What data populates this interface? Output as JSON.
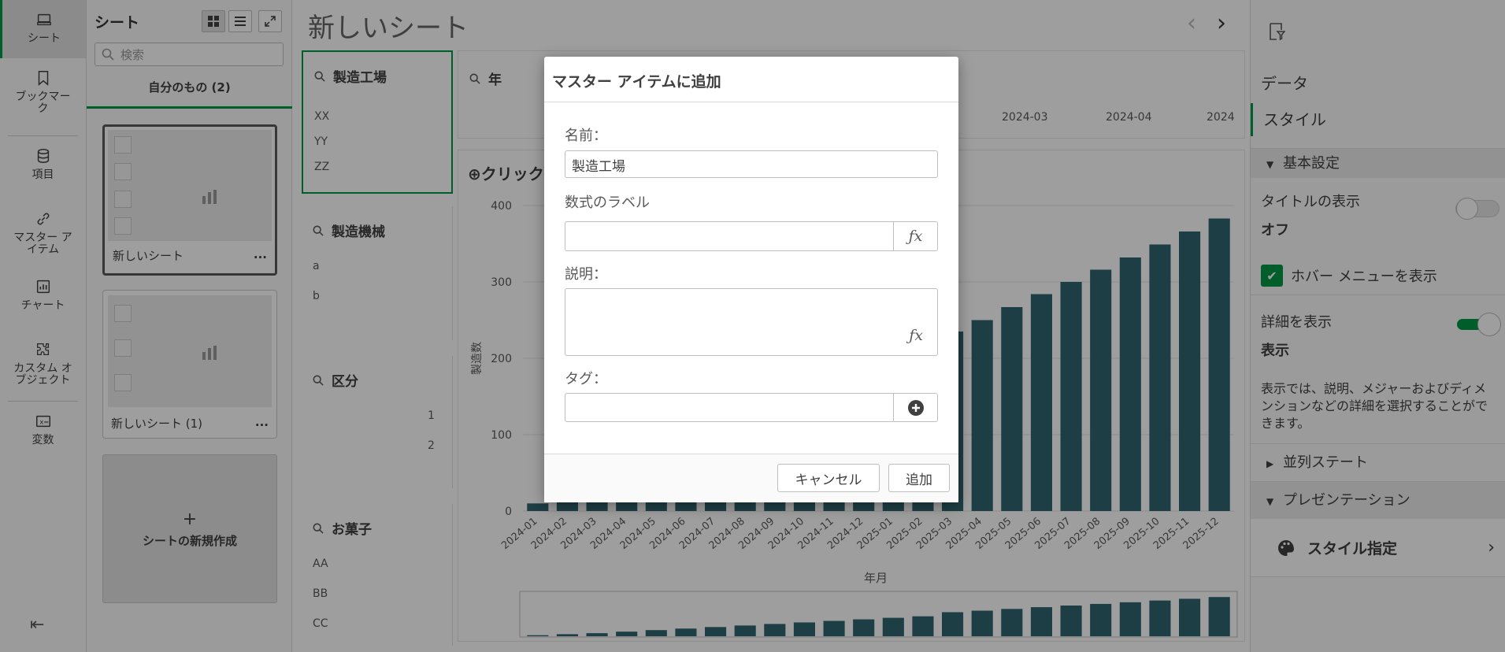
{
  "rail": {
    "items": [
      {
        "label": "シート",
        "icon": "sheet-icon",
        "active": true
      },
      {
        "label": "ブックマーク",
        "icon": "bookmark-icon"
      },
      {
        "label": "項目",
        "icon": "database-icon"
      },
      {
        "label": "マスター アイテム",
        "icon": "link-icon"
      },
      {
        "label": "チャート",
        "icon": "chart-icon"
      },
      {
        "label": "カスタム オブジェクト",
        "icon": "puzzle-icon"
      },
      {
        "label": "変数",
        "icon": "variable-icon"
      }
    ]
  },
  "sheets_panel": {
    "title": "シート",
    "search_placeholder": "検索",
    "tab_label": "自分のもの (2)",
    "cards": [
      {
        "name": "新しいシート",
        "more": "..."
      },
      {
        "name": "新しいシート (1)",
        "more": "..."
      }
    ],
    "new_sheet_label": "シートの新規作成",
    "new_sheet_plus": "+"
  },
  "main": {
    "sheet_title": "新しいシート",
    "filters": [
      {
        "title": "製造工場",
        "values": [
          "XX",
          "YY",
          "ZZ"
        ]
      },
      {
        "title": "製造機械",
        "values": [
          "a",
          "b"
        ]
      },
      {
        "title": "区分",
        "values": [
          "1",
          "2"
        ]
      },
      {
        "title": "お菓子",
        "values": [
          "AA",
          "BB",
          "CC"
        ]
      }
    ],
    "year_filter": {
      "title": "年",
      "visible_values": [
        "2024-03",
        "2024-04",
        "2024"
      ]
    },
    "chart_prompt": "クリック"
  },
  "chart_data": {
    "type": "bar",
    "ylabel": "製造数",
    "xlabel": "年月",
    "ylim": [
      0,
      400
    ],
    "yticks": [
      0,
      100,
      200,
      300,
      400
    ],
    "categories": [
      "2024-01",
      "2024-02",
      "2024-03",
      "2024-04",
      "2024-05",
      "2024-06",
      "2024-07",
      "2024-08",
      "2024-09",
      "2024-10",
      "2024-11",
      "2024-12",
      "2025-01",
      "2025-02",
      "2025-03",
      "2025-04",
      "2025-05",
      "2025-06",
      "2025-07",
      "2025-08",
      "2025-09",
      "2025-10",
      "2025-11",
      "2025-12"
    ],
    "values": [
      10,
      20,
      30,
      45,
      60,
      75,
      90,
      105,
      120,
      135,
      150,
      165,
      180,
      195,
      235,
      250,
      267,
      284,
      300,
      316,
      332,
      349,
      366,
      383
    ],
    "color": "#2f6470"
  },
  "props": {
    "tabs": [
      "データ",
      "スタイル"
    ],
    "basic_section": "基本設定",
    "title_display_label": "タイトルの表示",
    "title_display_value": "オフ",
    "hover_menu_label": "ホバー メニューを表示",
    "details_label": "詳細を表示",
    "details_value": "表示",
    "details_help": "表示では、説明、メジャーおよびディメンションなどの詳細を選択することができます。",
    "parallel_state": "並列ステート",
    "presentation": "プレゼンテーション",
    "style_spec": "スタイル指定",
    "accent": "#009845"
  },
  "dialog": {
    "title": "マスター アイテムに追加",
    "name_label": "名前：",
    "name_value": "製造工場",
    "expr_label": "数式のラベル",
    "desc_label": "説明：",
    "tag_label": "タグ：",
    "fx": "ƒx",
    "cancel_label": "キャンセル",
    "add_label": "追加"
  }
}
